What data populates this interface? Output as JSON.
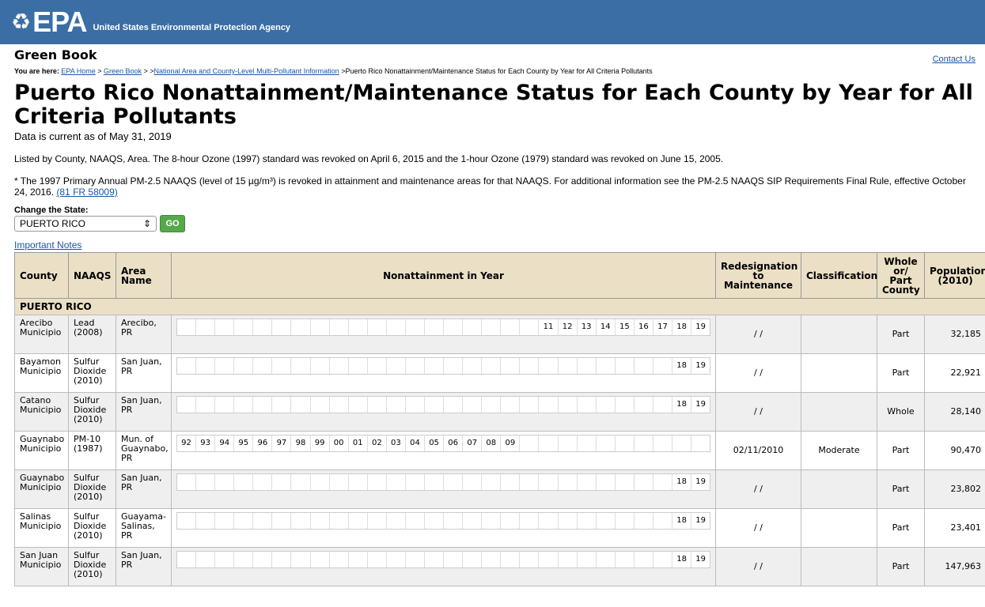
{
  "header": {
    "logo_mark": "♻",
    "logo_text": "EPA",
    "agency": "United States Environmental Protection Agency"
  },
  "site_title": "Green Book",
  "contact_label": "Contact Us",
  "breadcrumb": {
    "prefix": "You are here:",
    "items": [
      "EPA Home",
      "Green Book",
      "National Area and County-Level Multi-Pollutant Information"
    ],
    "current": "Puerto Rico Nonattainment/Maintenance Status for Each County by Year for All Criteria Pollutants"
  },
  "page_title": "Puerto Rico Nonattainment/Maintenance Status for Each County by Year for All Criteria Pollutants",
  "as_of": "Data is current as of May 31, 2019",
  "listed_note": "Listed by County, NAAQS, Area. The 8-hour Ozone (1997) standard was revoked on April 6, 2015 and the 1-hour Ozone (1979) standard was revoked on June 15, 2005.",
  "pm_note": "* The 1997 Primary Annual PM-2.5 NAAQS (level of 15 µg/m³) is revoked in attainment and maintenance areas for that NAAQS. For additional information see the PM-2.5 NAAQS SIP Requirements Final Rule, effective October 24, 2016.",
  "pm_note_link": "(81 FR 58009)",
  "state_select": {
    "label": "Change the State:",
    "value": "PUERTO RICO",
    "go_label": "GO"
  },
  "important_notes_label": "Important Notes",
  "table": {
    "headers": {
      "county": "County",
      "naaqs": "NAAQS",
      "area": "Area Name",
      "years": "Nonattainment in Year",
      "redesignation": "Redesignation to Maintenance",
      "classification": "Classification",
      "whole_part": "Whole or/ Part County",
      "population": "Population (2010)"
    },
    "state_name": "PUERTO RICO",
    "rows": [
      {
        "county": "Arecibo Municipio",
        "naaqs": "Lead (2008)",
        "area": "Arecibo, PR",
        "years": [
          "",
          "",
          "",
          "",
          "",
          "",
          "",
          "",
          "",
          "",
          "",
          "",
          "",
          "",
          "",
          "",
          "",
          "",
          "",
          "11",
          "12",
          "13",
          "14",
          "15",
          "16",
          "17",
          "18",
          "19"
        ],
        "redesignation": "/ /",
        "classification": "",
        "whole_part": "Part",
        "population": "32,185"
      },
      {
        "county": "Bayamon Municipio",
        "naaqs": "Sulfur Dioxide (2010)",
        "area": "San Juan, PR",
        "years": [
          "",
          "",
          "",
          "",
          "",
          "",
          "",
          "",
          "",
          "",
          "",
          "",
          "",
          "",
          "",
          "",
          "",
          "",
          "",
          "",
          "",
          "",
          "",
          "",
          "",
          "",
          "18",
          "19"
        ],
        "redesignation": "/ /",
        "classification": "",
        "whole_part": "Part",
        "population": "22,921"
      },
      {
        "county": "Catano Municipio",
        "naaqs": "Sulfur Dioxide (2010)",
        "area": "San Juan, PR",
        "years": [
          "",
          "",
          "",
          "",
          "",
          "",
          "",
          "",
          "",
          "",
          "",
          "",
          "",
          "",
          "",
          "",
          "",
          "",
          "",
          "",
          "",
          "",
          "",
          "",
          "",
          "",
          "18",
          "19"
        ],
        "redesignation": "/ /",
        "classification": "",
        "whole_part": "Whole",
        "population": "28,140"
      },
      {
        "county": "Guaynabo Municipio",
        "naaqs": "PM-10 (1987)",
        "area": "Mun. of Guaynabo, PR",
        "years": [
          "92",
          "93",
          "94",
          "95",
          "96",
          "97",
          "98",
          "99",
          "00",
          "01",
          "02",
          "03",
          "04",
          "05",
          "06",
          "07",
          "08",
          "09",
          "",
          "",
          "",
          "",
          "",
          "",
          "",
          "",
          "",
          ""
        ],
        "redesignation": "02/11/2010",
        "classification": "Moderate",
        "whole_part": "Part",
        "population": "90,470"
      },
      {
        "county": "Guaynabo Municipio",
        "naaqs": "Sulfur Dioxide (2010)",
        "area": "San Juan, PR",
        "years": [
          "",
          "",
          "",
          "",
          "",
          "",
          "",
          "",
          "",
          "",
          "",
          "",
          "",
          "",
          "",
          "",
          "",
          "",
          "",
          "",
          "",
          "",
          "",
          "",
          "",
          "",
          "18",
          "19"
        ],
        "redesignation": "/ /",
        "classification": "",
        "whole_part": "Part",
        "population": "23,802"
      },
      {
        "county": "Salinas Municipio",
        "naaqs": "Sulfur Dioxide (2010)",
        "area": "Guayama-Salinas, PR",
        "years": [
          "",
          "",
          "",
          "",
          "",
          "",
          "",
          "",
          "",
          "",
          "",
          "",
          "",
          "",
          "",
          "",
          "",
          "",
          "",
          "",
          "",
          "",
          "",
          "",
          "",
          "",
          "18",
          "19"
        ],
        "redesignation": "/ /",
        "classification": "",
        "whole_part": "Part",
        "population": "23,401"
      },
      {
        "county": "San Juan Municipio",
        "naaqs": "Sulfur Dioxide (2010)",
        "area": "San Juan, PR",
        "years": [
          "",
          "",
          "",
          "",
          "",
          "",
          "",
          "",
          "",
          "",
          "",
          "",
          "",
          "",
          "",
          "",
          "",
          "",
          "",
          "",
          "",
          "",
          "",
          "",
          "",
          "",
          "18",
          "19"
        ],
        "redesignation": "/ /",
        "classification": "",
        "whole_part": "Part",
        "population": "147,963"
      }
    ]
  }
}
